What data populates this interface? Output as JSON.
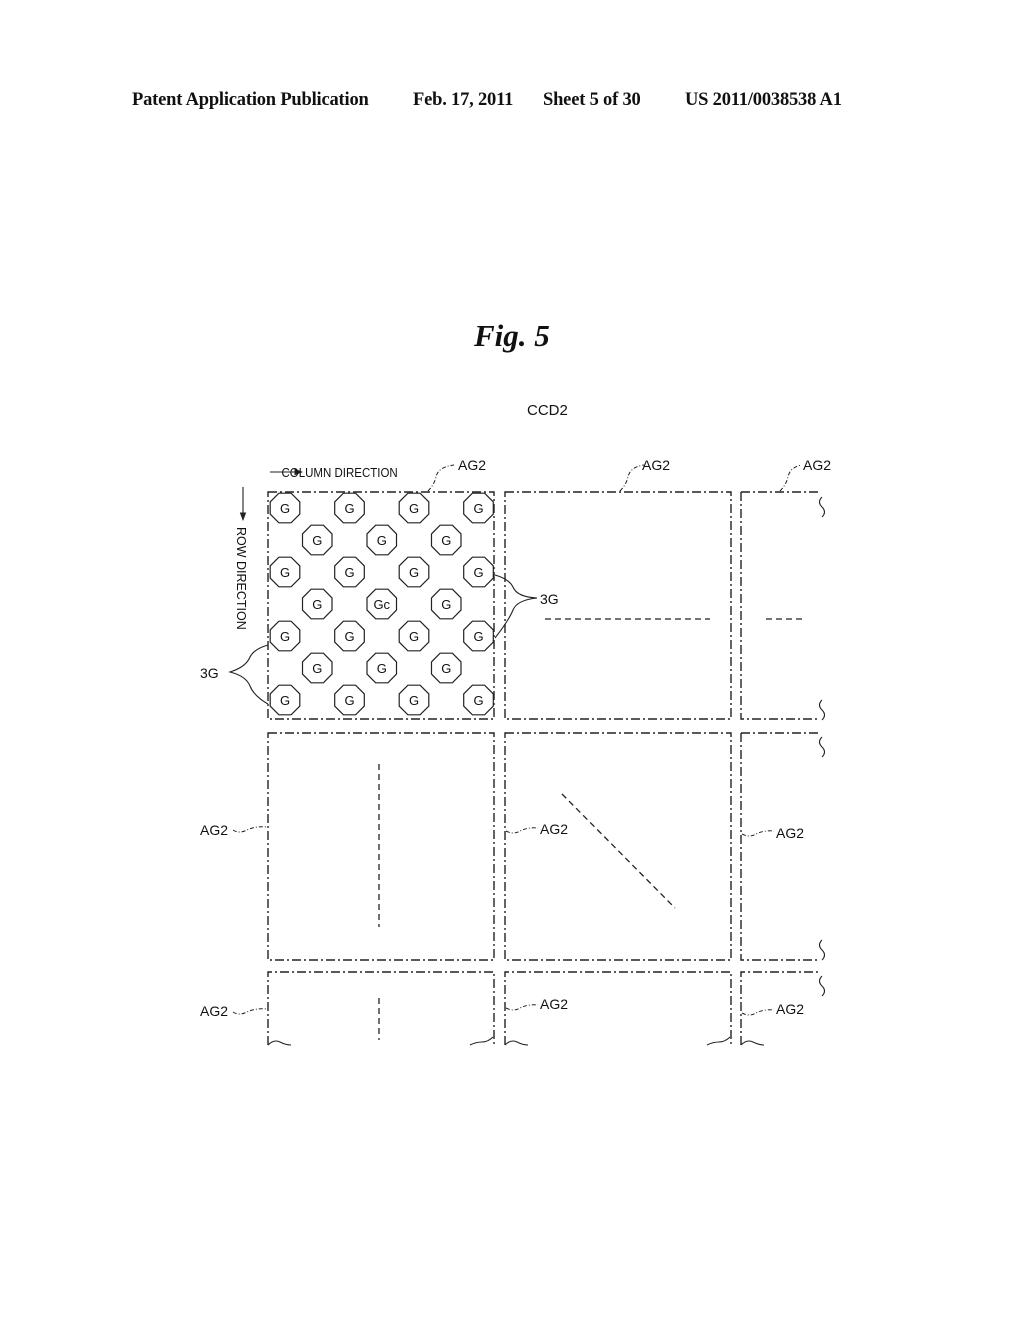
{
  "header": {
    "publication": "Patent Application Publication",
    "date": "Feb. 17, 2011",
    "sheet": "Sheet 5 of 30",
    "number": "US 2011/0038538 A1"
  },
  "figure": {
    "title": "Fig. 5",
    "device_label": "CCD2",
    "column_direction_label": "COLUMN DIRECTION",
    "row_direction_label": "ROW DIRECTION",
    "area_label": "AG2",
    "group_label": "3G",
    "cell_label": "G",
    "center_cell_label": "Gc",
    "grid": {
      "rows": 7,
      "odd_row_cells": 4,
      "even_row_cells": 3,
      "center_cell": {
        "row": 3,
        "col": 1
      }
    },
    "areas": [
      {
        "id": "top-left",
        "label": "AG2",
        "content": "cell-array"
      },
      {
        "id": "top-middle",
        "label": "AG2",
        "content": "horizontal-dashed-line"
      },
      {
        "id": "top-right",
        "label": "AG2",
        "content": "horizontal-dashed-line"
      },
      {
        "id": "middle-left",
        "label": "AG2",
        "content": "vertical-dashed-line"
      },
      {
        "id": "middle-middle",
        "label": "AG2",
        "content": "diagonal-dashed-line"
      },
      {
        "id": "middle-right",
        "label": "AG2",
        "content": "empty"
      },
      {
        "id": "bottom-left",
        "label": "AG2",
        "content": "vertical-dashed-line"
      },
      {
        "id": "bottom-middle",
        "label": "AG2",
        "content": "empty"
      },
      {
        "id": "bottom-right",
        "label": "AG2",
        "content": "empty"
      }
    ]
  }
}
